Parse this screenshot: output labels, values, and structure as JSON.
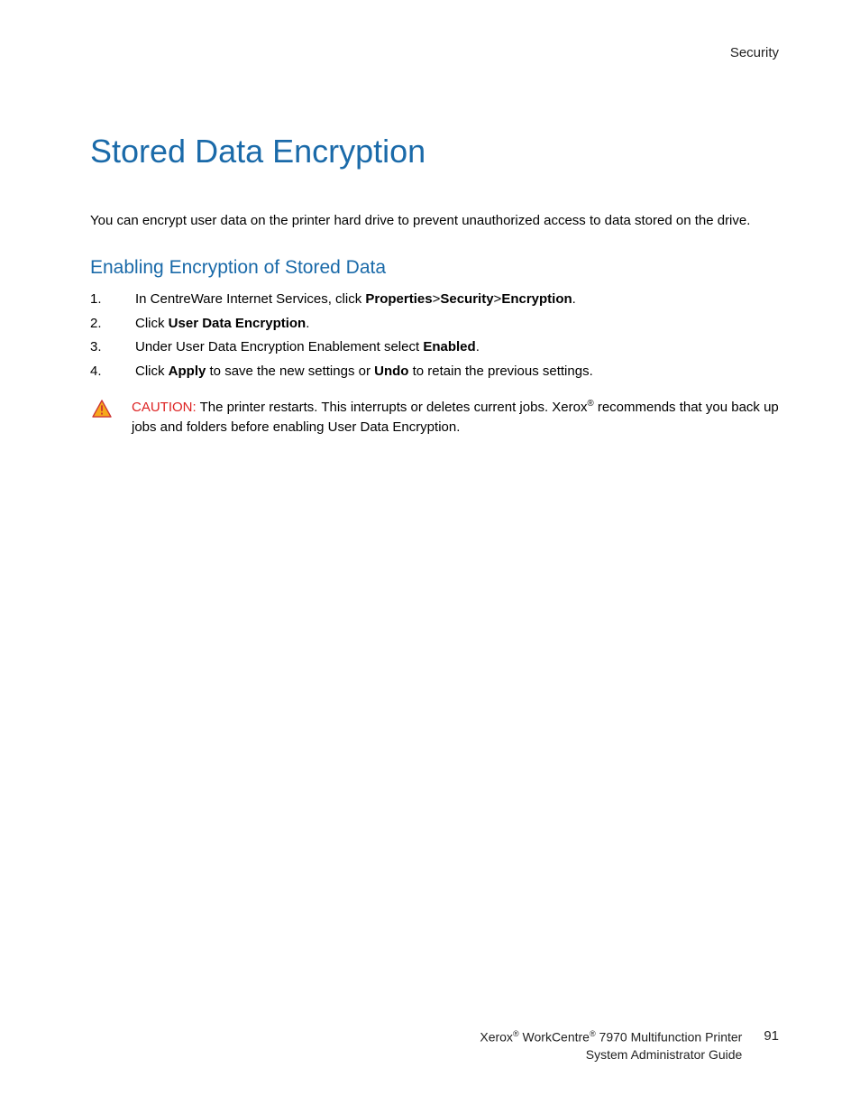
{
  "header": {
    "section": "Security"
  },
  "title": "Stored Data Encryption",
  "intro": "You can encrypt user data on the printer hard drive to prevent unauthorized access to data stored on the drive.",
  "subhead": "Enabling Encryption of Stored Data",
  "steps": {
    "s1_pre": "In CentreWare Internet Services, click ",
    "s1_b1": "Properties",
    "s1_gt1": ">",
    "s1_b2": "Security",
    "s1_gt2": ">",
    "s1_b3": "Encryption",
    "s1_post": ".",
    "s2_pre": "Click ",
    "s2_b": "User Data Encryption",
    "s2_post": ".",
    "s3_pre": "Under User Data Encryption Enablement select ",
    "s3_b": "Enabled",
    "s3_post": ".",
    "s4_pre": "Click ",
    "s4_b1": "Apply",
    "s4_mid": " to save the new settings or ",
    "s4_b2": "Undo",
    "s4_post": " to retain the previous settings."
  },
  "caution": {
    "label": "CAUTION:",
    "pre": " The printer restarts. This interrupts or deletes current jobs. Xerox",
    "reg": "®",
    "post": " recommends that you back up jobs and folders before enabling User Data Encryption."
  },
  "footer": {
    "brand1": "Xerox",
    "reg1": "®",
    "brand2": " WorkCentre",
    "reg2": "®",
    "line1_tail": " 7970 Multifunction Printer",
    "line2": "System Administrator Guide",
    "page": "91"
  }
}
